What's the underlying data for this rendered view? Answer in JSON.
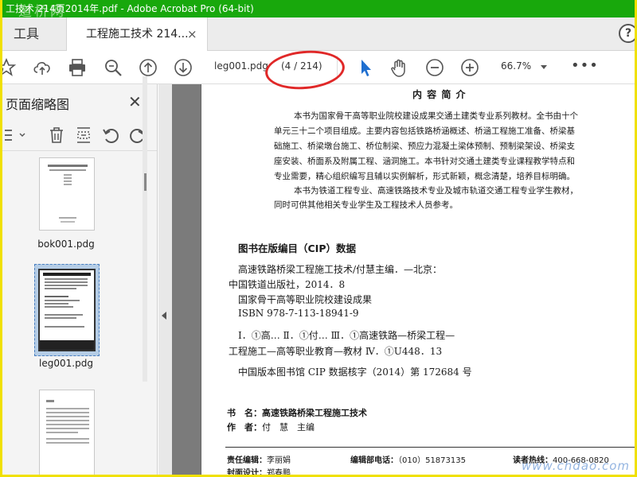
{
  "window": {
    "title": "工技术 214页2014年.pdf - Adobe Acrobat Pro (64-bit)",
    "watermark": "道桥网"
  },
  "tabs": {
    "tools": "工具",
    "document": "工程施工技术 214...",
    "close_glyph": "×",
    "help_glyph": "?"
  },
  "toolbar": {
    "page_field": "leg001.pdg",
    "page_count": "(4 / 214)",
    "zoom": "66.7%",
    "more": "•••"
  },
  "left_panel": {
    "title": "页面缩略图",
    "close_glyph": "✕",
    "thumbnails": [
      {
        "label": "bok001.pdg"
      },
      {
        "label": "leg001.pdg"
      },
      {
        "label": ""
      }
    ]
  },
  "document_page": {
    "intro_heading": "内 容 简 介",
    "intro_lines": [
      "本书为国家骨干高等职业院校建设成果交通土建类专业系列教材。全书由十个",
      "单元三十二个项目组成。主要内容包括铁路桥涵概述、桥涵工程施工准备、桥梁基",
      "础施工、桥梁墩台施工、桥位制梁、预应力混凝土梁体预制、预制梁架设、桥梁支",
      "座安装、桥面系及附属工程、涵洞施工。本书针对交通土建类专业课程教学特点和",
      "专业需要，精心组织编写且辅以实例解析，形式新颖，概念清楚，培养目标明确。",
      "本书为铁道工程专业、高速铁路技术专业及城市轨道交通工程专业学生教材，",
      "同时可供其他相关专业学生及工程技术人员参考。"
    ],
    "cip_heading": "图书在版编目（CIP）数据",
    "cip_lines": [
      "高速铁路桥梁工程施工技术/付慧主编．—北京：",
      "中国铁道出版社，2014．8",
      "国家骨干高等职业院校建设成果",
      "ISBN 978-7-113-18941-9",
      "Ⅰ．①高… Ⅱ．①付… Ⅲ．①高速铁路—桥梁工程—",
      "工程施工—高等职业教育—教材 Ⅳ．①U448．13",
      "中国版本图书馆 CIP 数据核字（2014）第 172684 号"
    ],
    "book_label": "书　名：",
    "book_name": "高速铁路桥梁工程施工技术",
    "author_label": "作　者：",
    "author_name": "付　慧　主编",
    "editor_label": "责任编辑：",
    "editor_name": "李丽娟",
    "phone_label": "编辑部电话：",
    "phone_value": "（010）51873135",
    "hotline_label": "读者热线：",
    "hotline_value": "400-668-0820",
    "cover_label": "封面设计：",
    "cover_name": "郑春鹏"
  },
  "site_watermark": "www.chdao.com",
  "colors": {
    "titlebar": "#18a80c",
    "frame": "#f0e000",
    "highlight_ring": "#e02828",
    "select_arrow": "#1f6fd0"
  },
  "icons": [
    "star-icon",
    "upload-icon",
    "print-icon",
    "search-zoom-icon",
    "page-up-icon",
    "page-down-icon",
    "select-arrow-icon",
    "hand-icon",
    "zoom-out-icon",
    "zoom-in-icon",
    "more-icon",
    "options-icon",
    "trash-icon",
    "page-extract-icon",
    "undo-icon",
    "redo-icon"
  ]
}
